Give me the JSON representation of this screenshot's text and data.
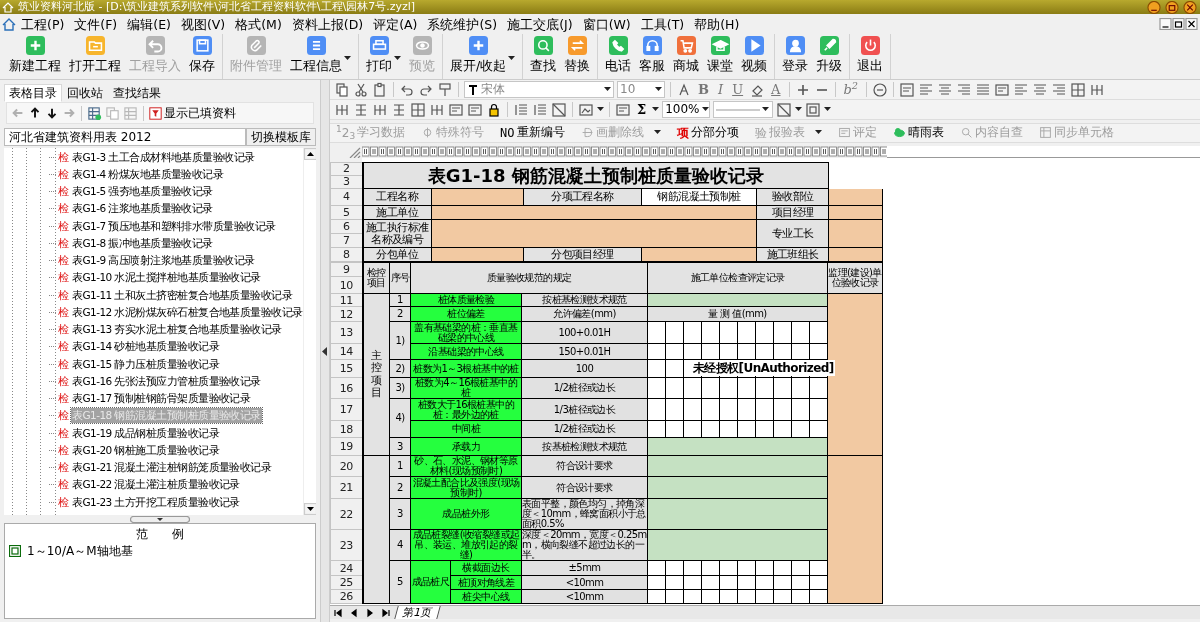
{
  "window": {
    "title": "筑业资料河北版 - [D:\\筑业建筑系列软件\\河北省工程资料软件\\工程\\园林7号.zyzl]"
  },
  "menu": [
    "工程(P)",
    "文件(F)",
    "编辑(E)",
    "视图(V)",
    "格式(M)",
    "资料上报(D)",
    "评定(A)",
    "系统维护(S)",
    "施工交底(J)",
    "窗口(W)",
    "工具(T)",
    "帮助(H)"
  ],
  "toolbar": [
    [
      {
        "label": "新建工程",
        "color": "#2ebd5c",
        "disabled": false,
        "dropdown": false
      },
      {
        "label": "打开工程",
        "color": "#f7b52c",
        "disabled": false,
        "dropdown": false
      },
      {
        "label": "工程导入",
        "color": "#b5b5b5",
        "disabled": true,
        "dropdown": false
      },
      {
        "label": "保存",
        "color": "#4f8ef5",
        "disabled": false,
        "dropdown": false
      }
    ],
    [
      {
        "label": "附件管理",
        "color": "#b5b5b5",
        "disabled": true,
        "dropdown": false
      },
      {
        "label": "工程信息",
        "color": "#4f8ef5",
        "disabled": false,
        "dropdown": true
      }
    ],
    [
      {
        "label": "打印",
        "color": "#4f8ef5",
        "disabled": false,
        "dropdown": true
      },
      {
        "label": "预览",
        "color": "#b5b5b5",
        "disabled": true,
        "dropdown": false
      }
    ],
    [
      {
        "label": "展开/收起",
        "color": "#4f8ef5",
        "disabled": false,
        "dropdown": true
      }
    ],
    [
      {
        "label": "查找",
        "color": "#2ebd5c",
        "disabled": false,
        "dropdown": false
      },
      {
        "label": "替换",
        "color": "#f79a2c",
        "disabled": false,
        "dropdown": false
      }
    ],
    [
      {
        "label": "电话",
        "color": "#2ebd5c",
        "disabled": false,
        "dropdown": false
      },
      {
        "label": "客服",
        "color": "#4f8ef5",
        "disabled": false,
        "dropdown": false
      },
      {
        "label": "商城",
        "color": "#f0703c",
        "disabled": false,
        "dropdown": false
      },
      {
        "label": "课堂",
        "color": "#2ebd5c",
        "disabled": false,
        "dropdown": false
      },
      {
        "label": "视频",
        "color": "#4f8ef5",
        "disabled": false,
        "dropdown": false
      }
    ],
    [
      {
        "label": "登录",
        "color": "#4f8ef5",
        "disabled": false,
        "dropdown": false
      },
      {
        "label": "升级",
        "color": "#2ebd5c",
        "disabled": false,
        "dropdown": false
      }
    ],
    [
      {
        "label": "退出",
        "color": "#f05050",
        "disabled": false,
        "dropdown": false
      }
    ]
  ],
  "left_panel": {
    "tabs": [
      {
        "label": "表格目录",
        "selected": true
      },
      {
        "label": "回收站",
        "selected": false
      },
      {
        "label": "查找结果",
        "selected": false
      }
    ],
    "nav_buttons": [
      {
        "disabled": true
      },
      {
        "disabled": false
      },
      {
        "disabled": false
      },
      {
        "disabled": true
      }
    ],
    "table_buttons": [
      {
        "disabled": false
      },
      {
        "disabled": true
      },
      {
        "disabled": true
      }
    ],
    "filter_button": "显示已填资料",
    "library": {
      "value": "河北省建筑资料用表 2012",
      "button": "切换模板库"
    },
    "tree": [
      {
        "badge": "检",
        "label": "表G1-3 土工合成材料地基质量验收记录",
        "selected": false
      },
      {
        "badge": "检",
        "label": "表G1-4 粉煤灰地基质量验收记录",
        "selected": false
      },
      {
        "badge": "检",
        "label": "表G1-5 强夯地基质量验收记录",
        "selected": false
      },
      {
        "badge": "检",
        "label": "表G1-6 注浆地基质量验收记录",
        "selected": false
      },
      {
        "badge": "检",
        "label": "表G1-7 预压地基和塑料排水带质量验收记录",
        "selected": false
      },
      {
        "badge": "检",
        "label": "表G1-8 振冲地基质量验收记录",
        "selected": false
      },
      {
        "badge": "检",
        "label": "表G1-9 高压喷射注浆地基质量验收记录",
        "selected": false
      },
      {
        "badge": "检",
        "label": "表G1-10 水泥土搅拌桩地基质量验收记录",
        "selected": false
      },
      {
        "badge": "检",
        "label": "表G1-11 土和灰土挤密桩复合地基质量验收记录",
        "selected": false
      },
      {
        "badge": "检",
        "label": "表G1-12 水泥粉煤灰碎石桩复合地基质量验收记录",
        "selected": false
      },
      {
        "badge": "检",
        "label": "表G1-13 夯实水泥土桩复合地基质量验收记录",
        "selected": false
      },
      {
        "badge": "检",
        "label": "表G1-14 砂桩地基质量验收记录",
        "selected": false
      },
      {
        "badge": "检",
        "label": "表G1-15 静力压桩质量验收记录",
        "selected": false
      },
      {
        "badge": "检",
        "label": "表G1-16 先张法预应力管桩质量验收记录",
        "selected": false
      },
      {
        "badge": "检",
        "label": "表G1-17 预制桩钢筋骨架质量验收记录",
        "selected": false
      },
      {
        "badge": "检",
        "label": "表G1-18 钢筋混凝土预制桩质量验收记录",
        "selected": true
      },
      {
        "badge": "检",
        "label": "表G1-19 成品钢桩质量验收记录",
        "selected": false
      },
      {
        "badge": "检",
        "label": "表G1-20 钢桩施工质量验收记录",
        "selected": false
      },
      {
        "badge": "检",
        "label": "表G1-21 混凝土灌注桩钢筋笼质量验收记录",
        "selected": false
      },
      {
        "badge": "检",
        "label": "表G1-22 混凝土灌注桩质量验收记录",
        "selected": false
      },
      {
        "badge": "检",
        "label": "表G1-23 土方开挖工程质量验收记录",
        "selected": false
      }
    ],
    "legend": {
      "title": "范　　例",
      "items": [
        {
          "label": "1～10/A～M轴地基"
        }
      ]
    }
  },
  "format_bar": {
    "font": "宋体",
    "font_size": "10",
    "bold": "B",
    "italic": "I",
    "underline": "U",
    "font_color": "A",
    "superscript": "b$^{2}$",
    "sum": "Σ",
    "zoom": "100%"
  },
  "commands": [
    {
      "icon_text": "$^{1}$2$_{3}$",
      "label": "学习数据",
      "disabled": true,
      "dropdown": false
    },
    {
      "label": "特殊符号",
      "disabled": true,
      "dropdown": false
    },
    {
      "icon_text": "NO",
      "label": "重新编号",
      "disabled": false,
      "dropdown": false
    },
    {
      "label": "画删除线",
      "disabled": true,
      "dropdown": true
    },
    {
      "icon_text": "项",
      "label": "分部分项",
      "disabled": false,
      "dropdown": false
    },
    {
      "icon_text": "验",
      "label": "报验表",
      "disabled": true,
      "dropdown": true
    },
    {
      "label": "评定",
      "disabled": true,
      "dropdown": false
    },
    {
      "label": "晴雨表",
      "disabled": false,
      "dropdown": false
    },
    {
      "label": "内容自查",
      "disabled": true,
      "dropdown": false
    },
    {
      "label": "同步单元格",
      "disabled": true,
      "dropdown": false
    }
  ],
  "sheet": {
    "header_rows": [
      {
        "number": "2",
        "cells": [
          {
            "kind": "title",
            "text": "表G1-18  钢筋混凝土预制桩质量验收记录"
          },
          {
            "kind": "blank"
          }
        ]
      },
      {
        "number": "3",
        "cells": []
      },
      {
        "number": "4",
        "cells": [
          {
            "kind": "label",
            "text": "工程名称"
          },
          {
            "kind": "input"
          },
          {
            "kind": "label",
            "text": "分项工程名称"
          },
          {
            "kind": "plain",
            "text": "钢筋混凝土预制桩"
          },
          {
            "kind": "label",
            "text": "验收部位"
          },
          {
            "kind": "input"
          }
        ]
      },
      {
        "number": "5",
        "cells": [
          {
            "kind": "label",
            "text": "施工单位"
          },
          {
            "kind": "input"
          },
          {
            "kind": "label",
            "text": "项目经理"
          },
          {
            "kind": "input"
          }
        ]
      },
      {
        "number": "6",
        "cells": [
          {
            "kind": "label",
            "text": "施工执行标准名称及编号"
          },
          {
            "kind": "input"
          },
          {
            "kind": "label",
            "text": "专业工长"
          },
          {
            "kind": "input"
          }
        ]
      },
      {
        "number": "7",
        "cells": []
      },
      {
        "number": "8",
        "cells": [
          {
            "kind": "label",
            "text": "分包单位"
          },
          {
            "kind": "input"
          },
          {
            "kind": "label",
            "text": "分包项目经理"
          },
          {
            "kind": "input"
          },
          {
            "kind": "label",
            "text": "施工班组长"
          },
          {
            "kind": "input"
          }
        ]
      }
    ],
    "body_rows": [
      {
        "number": "9",
        "cells": [
          {
            "kind": "label",
            "text": "检控项目"
          },
          {
            "kind": "label",
            "text": "序号"
          },
          {
            "kind": "label",
            "text": "质量验收规范的规定"
          },
          {
            "kind": "label",
            "text": "施工单位检查评定记录"
          },
          {
            "kind": "label",
            "text": "监理(建设)单位验收记录"
          }
        ]
      },
      {
        "number": "10",
        "cells": []
      },
      {
        "number": "11",
        "cells": [
          {
            "kind": "side",
            "text": "主控项目"
          },
          {
            "kind": "label",
            "text": "1"
          },
          {
            "kind": "spec",
            "text": "桩体质量检验"
          },
          {
            "kind": "value",
            "text": "按桩基检测技术规范"
          },
          {
            "kind": "record"
          },
          {
            "kind": "input"
          }
        ]
      },
      {
        "number": "12",
        "cells": [
          {
            "kind": "label",
            "text": "2"
          },
          {
            "kind": "spec",
            "text": "桩位偏差"
          },
          {
            "kind": "value",
            "text": "允许偏差(mm)"
          },
          {
            "kind": "value",
            "text": "量  测  值(mm)"
          }
        ]
      },
      {
        "number": "13",
        "cells": [
          {
            "kind": "label",
            "text": "1)"
          },
          {
            "kind": "spec",
            "text": "盖有基础梁的桩：垂直基础梁的中心线"
          },
          {
            "kind": "value",
            "text": "100+0.01H"
          },
          {
            "kind": "grid"
          }
        ]
      },
      {
        "number": "14",
        "cells": [
          {
            "kind": "spec",
            "text": "沿基础梁的中心线"
          },
          {
            "kind": "value",
            "text": "150+0.01H"
          },
          {
            "kind": "grid"
          }
        ]
      },
      {
        "number": "15",
        "cells": [
          {
            "kind": "label",
            "text": "2)"
          },
          {
            "kind": "spec",
            "text": "桩数为1～3根桩基中的桩"
          },
          {
            "kind": "value",
            "text": "100"
          },
          {
            "kind": "grid",
            "overlay": "未经授权[UnAuthorized]"
          }
        ]
      },
      {
        "number": "16",
        "cells": [
          {
            "kind": "label",
            "text": "3)"
          },
          {
            "kind": "spec",
            "text": "桩数为4～16根桩基中的桩"
          },
          {
            "kind": "value",
            "text": "1/2桩径或边长"
          },
          {
            "kind": "grid"
          }
        ]
      },
      {
        "number": "17",
        "cells": [
          {
            "kind": "label",
            "text": "4)"
          },
          {
            "kind": "spec",
            "text": "桩数大于16根桩基中的桩：最外边的桩"
          },
          {
            "kind": "value",
            "text": "1/3桩径或边长"
          },
          {
            "kind": "grid"
          }
        ]
      },
      {
        "number": "18",
        "cells": [
          {
            "kind": "spec",
            "text": "中间桩"
          },
          {
            "kind": "value",
            "text": "1/2桩径或边长"
          },
          {
            "kind": "grid"
          }
        ]
      },
      {
        "number": "19",
        "cells": [
          {
            "kind": "label",
            "text": "3"
          },
          {
            "kind": "spec",
            "text": "承载力"
          },
          {
            "kind": "value",
            "text": "按基桩检测技术规范"
          },
          {
            "kind": "record"
          }
        ]
      },
      {
        "number": "20",
        "cells": [
          {
            "kind": "side"
          },
          {
            "kind": "label",
            "text": "1"
          },
          {
            "kind": "spec",
            "text": "砂、石、水泥、钢材等原材料(现场预制时)"
          },
          {
            "kind": "value",
            "text": "符合设计要求"
          },
          {
            "kind": "record"
          },
          {
            "kind": "input"
          }
        ]
      },
      {
        "number": "21",
        "cells": [
          {
            "kind": "label",
            "text": "2"
          },
          {
            "kind": "spec",
            "text": "混凝土配合比及强度(现场预制时)"
          },
          {
            "kind": "value",
            "text": "符合设计要求"
          },
          {
            "kind": "record"
          }
        ]
      },
      {
        "number": "22",
        "cells": [
          {
            "kind": "label",
            "text": "3"
          },
          {
            "kind": "spec",
            "text": "成品桩外形"
          },
          {
            "kind": "value",
            "text": "表面平整，颜色均匀，掉角深度＜10mm，蜂窝面积小于总面积0.5%"
          },
          {
            "kind": "record"
          }
        ]
      },
      {
        "number": "23",
        "cells": [
          {
            "kind": "label",
            "text": "4"
          },
          {
            "kind": "spec",
            "text": "成品桩裂缝(收缩裂缝或起吊、装运、堆放引起的裂缝)"
          },
          {
            "kind": "value",
            "text": "深度＜20mm，宽度＜0.25mm，横向裂缝不超过边长的一半。"
          },
          {
            "kind": "record"
          }
        ]
      },
      {
        "number": "24",
        "cells": [
          {
            "kind": "label",
            "text": "5"
          },
          {
            "kind": "spec",
            "text": "成品桩尺"
          },
          {
            "kind": "spec",
            "text": "横截面边长"
          },
          {
            "kind": "value",
            "text": "±5mm"
          },
          {
            "kind": "grid"
          }
        ]
      },
      {
        "number": "25",
        "cells": [
          {
            "kind": "spec",
            "text": "桩顶对角线差"
          },
          {
            "kind": "value",
            "text": "<10mm"
          },
          {
            "kind": "grid"
          }
        ]
      },
      {
        "number": "26",
        "cells": [
          {
            "kind": "spec",
            "text": "桩尖中心线"
          },
          {
            "kind": "value",
            "text": "<10mm"
          },
          {
            "kind": "grid"
          }
        ]
      }
    ]
  },
  "sheet_tabs": [
    {
      "label": "第1页",
      "selected": true
    }
  ]
}
